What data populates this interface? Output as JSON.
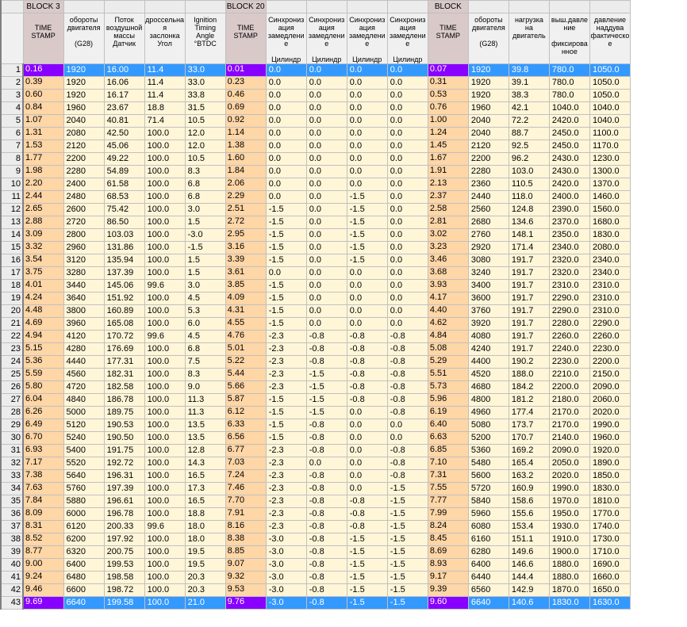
{
  "colors": {
    "cell_bg": "#fff6d8",
    "timestamp_bg": "#ffd6a6",
    "selected_row": "#3399ff",
    "selected_timestamp": "#8800ff",
    "header_timestamp": "#d9c9c9"
  },
  "blocks": [
    "BLOCK 3",
    "",
    "",
    "",
    "",
    "BLOCK 20",
    "",
    "",
    "",
    "",
    "BLOCK",
    "",
    "",
    "",
    ""
  ],
  "columns": [
    {
      "lines": [
        "",
        "TIME",
        "STAMP",
        ""
      ],
      "ts": true
    },
    {
      "lines": [
        "обороты",
        "двигателя",
        "",
        "(G28)"
      ]
    },
    {
      "lines": [
        "Поток",
        "воздушной",
        "массы",
        "Датчик"
      ]
    },
    {
      "lines": [
        "дроссельная",
        "заслонка",
        "Угол",
        ""
      ]
    },
    {
      "lines": [
        "Ignition",
        "Timing",
        "Angle",
        "°BTDC"
      ]
    },
    {
      "lines": [
        "",
        "TIME",
        "STAMP",
        ""
      ],
      "ts": true
    },
    {
      "lines": [
        "Синхронизация",
        "замедление",
        "",
        "Цилиндр"
      ]
    },
    {
      "lines": [
        "Синхронизация",
        "замедление",
        "",
        "Цилиндр"
      ]
    },
    {
      "lines": [
        "Синхронизация",
        "замедление",
        "",
        "Цилиндр"
      ]
    },
    {
      "lines": [
        "Синхронизация",
        "замедление",
        "",
        "Цилиндр"
      ]
    },
    {
      "lines": [
        "",
        "TIME",
        "STAMP",
        ""
      ],
      "ts": true
    },
    {
      "lines": [
        "обороты",
        "двигателя",
        "",
        "(G28)"
      ]
    },
    {
      "lines": [
        "нагрузка",
        "на",
        "двигатель",
        ""
      ]
    },
    {
      "lines": [
        "выш.давление",
        "",
        "фиксированное",
        ""
      ]
    },
    {
      "lines": [
        "давление",
        "наддува",
        "фактическое",
        ""
      ]
    }
  ],
  "selected_rows": [
    1,
    43
  ],
  "rows": [
    [
      "0.16",
      "1920",
      "16.00",
      "11.4",
      "33.0",
      "0.01",
      "0.0",
      "0.0",
      "0.0",
      "0.0",
      "0.07",
      "1920",
      "39.8",
      "780.0",
      "1050.0"
    ],
    [
      "0.39",
      "1920",
      "16.06",
      "11.4",
      "33.0",
      "0.23",
      "0.0",
      "0.0",
      "0.0",
      "0.0",
      "0.31",
      "1920",
      "39.1",
      "780.0",
      "1050.0"
    ],
    [
      "0.60",
      "1920",
      "16.17",
      "11.4",
      "33.8",
      "0.46",
      "0.0",
      "0.0",
      "0.0",
      "0.0",
      "0.53",
      "1920",
      "38.3",
      "780.0",
      "1050.0"
    ],
    [
      "0.84",
      "1960",
      "23.67",
      "18.8",
      "31.5",
      "0.69",
      "0.0",
      "0.0",
      "0.0",
      "0.0",
      "0.76",
      "1960",
      "42.1",
      "1040.0",
      "1040.0"
    ],
    [
      "1.07",
      "2040",
      "40.81",
      "71.4",
      "10.5",
      "0.92",
      "0.0",
      "0.0",
      "0.0",
      "0.0",
      "1.00",
      "2040",
      "72.2",
      "2420.0",
      "1040.0"
    ],
    [
      "1.31",
      "2080",
      "42.50",
      "100.0",
      "12.0",
      "1.14",
      "0.0",
      "0.0",
      "0.0",
      "0.0",
      "1.24",
      "2040",
      "88.7",
      "2450.0",
      "1100.0"
    ],
    [
      "1.53",
      "2120",
      "45.06",
      "100.0",
      "12.0",
      "1.38",
      "0.0",
      "0.0",
      "0.0",
      "0.0",
      "1.45",
      "2120",
      "92.5",
      "2450.0",
      "1170.0"
    ],
    [
      "1.77",
      "2200",
      "49.22",
      "100.0",
      "10.5",
      "1.60",
      "0.0",
      "0.0",
      "0.0",
      "0.0",
      "1.67",
      "2200",
      "96.2",
      "2430.0",
      "1230.0"
    ],
    [
      "1.98",
      "2280",
      "54.89",
      "100.0",
      "8.3",
      "1.84",
      "0.0",
      "0.0",
      "0.0",
      "0.0",
      "1.91",
      "2280",
      "103.0",
      "2430.0",
      "1300.0"
    ],
    [
      "2.20",
      "2400",
      "61.58",
      "100.0",
      "6.8",
      "2.06",
      "0.0",
      "0.0",
      "0.0",
      "0.0",
      "2.13",
      "2360",
      "110.5",
      "2420.0",
      "1370.0"
    ],
    [
      "2.44",
      "2480",
      "68.53",
      "100.0",
      "6.8",
      "2.29",
      "0.0",
      "0.0",
      "-1.5",
      "0.0",
      "2.37",
      "2440",
      "118.0",
      "2400.0",
      "1460.0"
    ],
    [
      "2.65",
      "2600",
      "75.42",
      "100.0",
      "3.0",
      "2.51",
      "-1.5",
      "0.0",
      "-1.5",
      "0.0",
      "2.58",
      "2560",
      "124.8",
      "2390.0",
      "1560.0"
    ],
    [
      "2.88",
      "2720",
      "86.50",
      "100.0",
      "1.5",
      "2.72",
      "-1.5",
      "0.0",
      "-1.5",
      "0.0",
      "2.81",
      "2680",
      "134.6",
      "2370.0",
      "1680.0"
    ],
    [
      "3.09",
      "2800",
      "103.03",
      "100.0",
      "-3.0",
      "2.95",
      "-1.5",
      "0.0",
      "-1.5",
      "0.0",
      "3.02",
      "2760",
      "148.1",
      "2350.0",
      "1830.0"
    ],
    [
      "3.32",
      "2960",
      "131.86",
      "100.0",
      "-1.5",
      "3.16",
      "-1.5",
      "0.0",
      "-1.5",
      "0.0",
      "3.23",
      "2920",
      "171.4",
      "2340.0",
      "2080.0"
    ],
    [
      "3.54",
      "3120",
      "135.94",
      "100.0",
      "1.5",
      "3.39",
      "-1.5",
      "0.0",
      "-1.5",
      "0.0",
      "3.46",
      "3080",
      "191.7",
      "2320.0",
      "2340.0"
    ],
    [
      "3.75",
      "3280",
      "137.39",
      "100.0",
      "1.5",
      "3.61",
      "0.0",
      "0.0",
      "0.0",
      "0.0",
      "3.68",
      "3240",
      "191.7",
      "2320.0",
      "2340.0"
    ],
    [
      "4.01",
      "3440",
      "145.06",
      "99.6",
      "3.0",
      "3.85",
      "-1.5",
      "0.0",
      "0.0",
      "0.0",
      "3.93",
      "3400",
      "191.7",
      "2310.0",
      "2310.0"
    ],
    [
      "4.24",
      "3640",
      "151.92",
      "100.0",
      "4.5",
      "4.09",
      "-1.5",
      "0.0",
      "0.0",
      "0.0",
      "4.17",
      "3600",
      "191.7",
      "2290.0",
      "2310.0"
    ],
    [
      "4.48",
      "3800",
      "160.89",
      "100.0",
      "5.3",
      "4.31",
      "-1.5",
      "0.0",
      "0.0",
      "0.0",
      "4.40",
      "3760",
      "191.7",
      "2290.0",
      "2310.0"
    ],
    [
      "4.69",
      "3960",
      "165.08",
      "100.0",
      "6.0",
      "4.55",
      "-1.5",
      "0.0",
      "0.0",
      "0.0",
      "4.62",
      "3920",
      "191.7",
      "2280.0",
      "2290.0"
    ],
    [
      "4.94",
      "4120",
      "170.72",
      "99.6",
      "4.5",
      "4.76",
      "-2.3",
      "-0.8",
      "-0.8",
      "-0.8",
      "4.84",
      "4080",
      "191.7",
      "2260.0",
      "2260.0"
    ],
    [
      "5.15",
      "4280",
      "176.69",
      "100.0",
      "6.8",
      "5.01",
      "-2.3",
      "-0.8",
      "-0.8",
      "-0.8",
      "5.08",
      "4240",
      "191.7",
      "2240.0",
      "2230.0"
    ],
    [
      "5.36",
      "4440",
      "177.31",
      "100.0",
      "7.5",
      "5.22",
      "-2.3",
      "-0.8",
      "-0.8",
      "-0.8",
      "5.29",
      "4400",
      "190.2",
      "2230.0",
      "2200.0"
    ],
    [
      "5.59",
      "4560",
      "182.31",
      "100.0",
      "8.3",
      "5.44",
      "-2.3",
      "-1.5",
      "-0.8",
      "-0.8",
      "5.51",
      "4520",
      "188.0",
      "2210.0",
      "2150.0"
    ],
    [
      "5.80",
      "4720",
      "182.58",
      "100.0",
      "9.0",
      "5.66",
      "-2.3",
      "-1.5",
      "-0.8",
      "-0.8",
      "5.73",
      "4680",
      "184.2",
      "2200.0",
      "2090.0"
    ],
    [
      "6.04",
      "4840",
      "186.78",
      "100.0",
      "11.3",
      "5.87",
      "-1.5",
      "-1.5",
      "-0.8",
      "-0.8",
      "5.96",
      "4800",
      "181.2",
      "2180.0",
      "2060.0"
    ],
    [
      "6.26",
      "5000",
      "189.75",
      "100.0",
      "11.3",
      "6.12",
      "-1.5",
      "-1.5",
      "0.0",
      "-0.8",
      "6.19",
      "4960",
      "177.4",
      "2170.0",
      "2020.0"
    ],
    [
      "6.49",
      "5120",
      "190.53",
      "100.0",
      "13.5",
      "6.33",
      "-1.5",
      "-0.8",
      "0.0",
      "0.0",
      "6.40",
      "5080",
      "173.7",
      "2170.0",
      "1990.0"
    ],
    [
      "6.70",
      "5240",
      "190.50",
      "100.0",
      "13.5",
      "6.56",
      "-1.5",
      "-0.8",
      "0.0",
      "0.0",
      "6.63",
      "5200",
      "170.7",
      "2140.0",
      "1960.0"
    ],
    [
      "6.93",
      "5400",
      "191.75",
      "100.0",
      "12.8",
      "6.77",
      "-2.3",
      "-0.8",
      "0.0",
      "-0.8",
      "6.85",
      "5360",
      "169.2",
      "2090.0",
      "1920.0"
    ],
    [
      "7.17",
      "5520",
      "192.72",
      "100.0",
      "14.3",
      "7.03",
      "-2.3",
      "0.0",
      "0.0",
      "-0.8",
      "7.10",
      "5480",
      "165.4",
      "2050.0",
      "1890.0"
    ],
    [
      "7.38",
      "5640",
      "196.31",
      "100.0",
      "16.5",
      "7.24",
      "-2.3",
      "-0.8",
      "0.0",
      "-0.8",
      "7.31",
      "5600",
      "163.2",
      "2020.0",
      "1850.0"
    ],
    [
      "7.63",
      "5760",
      "197.39",
      "100.0",
      "17.3",
      "7.46",
      "-2.3",
      "-0.8",
      "0.0",
      "-1.5",
      "7.55",
      "5720",
      "160.9",
      "1990.0",
      "1830.0"
    ],
    [
      "7.84",
      "5880",
      "196.61",
      "100.0",
      "16.5",
      "7.70",
      "-2.3",
      "-0.8",
      "-0.8",
      "-1.5",
      "7.77",
      "5840",
      "158.6",
      "1970.0",
      "1810.0"
    ],
    [
      "8.09",
      "6000",
      "196.78",
      "100.0",
      "18.8",
      "7.91",
      "-2.3",
      "-0.8",
      "-0.8",
      "-1.5",
      "7.99",
      "5960",
      "155.6",
      "1950.0",
      "1770.0"
    ],
    [
      "8.31",
      "6120",
      "200.33",
      "99.6",
      "18.0",
      "8.16",
      "-2.3",
      "-0.8",
      "-0.8",
      "-1.5",
      "8.24",
      "6080",
      "153.4",
      "1930.0",
      "1740.0"
    ],
    [
      "8.52",
      "6200",
      "197.92",
      "100.0",
      "18.0",
      "8.38",
      "-3.0",
      "-0.8",
      "-1.5",
      "-1.5",
      "8.45",
      "6160",
      "151.1",
      "1910.0",
      "1730.0"
    ],
    [
      "8.77",
      "6320",
      "200.75",
      "100.0",
      "19.5",
      "8.85",
      "-3.0",
      "-0.8",
      "-1.5",
      "-1.5",
      "8.69",
      "6280",
      "149.6",
      "1900.0",
      "1710.0"
    ],
    [
      "9.00",
      "6400",
      "199.53",
      "100.0",
      "19.5",
      "9.07",
      "-3.0",
      "-0.8",
      "-1.5",
      "-1.5",
      "8.93",
      "6400",
      "146.6",
      "1880.0",
      "1690.0"
    ],
    [
      "9.24",
      "6480",
      "198.58",
      "100.0",
      "20.3",
      "9.32",
      "-3.0",
      "-0.8",
      "-1.5",
      "-1.5",
      "9.17",
      "6440",
      "144.4",
      "1880.0",
      "1660.0"
    ],
    [
      "9.46",
      "6600",
      "198.72",
      "100.0",
      "20.3",
      "9.53",
      "-3.0",
      "-0.8",
      "-1.5",
      "-1.5",
      "9.39",
      "6560",
      "142.9",
      "1870.0",
      "1650.0"
    ],
    [
      "9.69",
      "6640",
      "199.58",
      "100.0",
      "21.0",
      "9.76",
      "-3.0",
      "-0.8",
      "-1.5",
      "-1.5",
      "9.60",
      "6640",
      "140.6",
      "1830.0",
      "1630.0"
    ]
  ]
}
